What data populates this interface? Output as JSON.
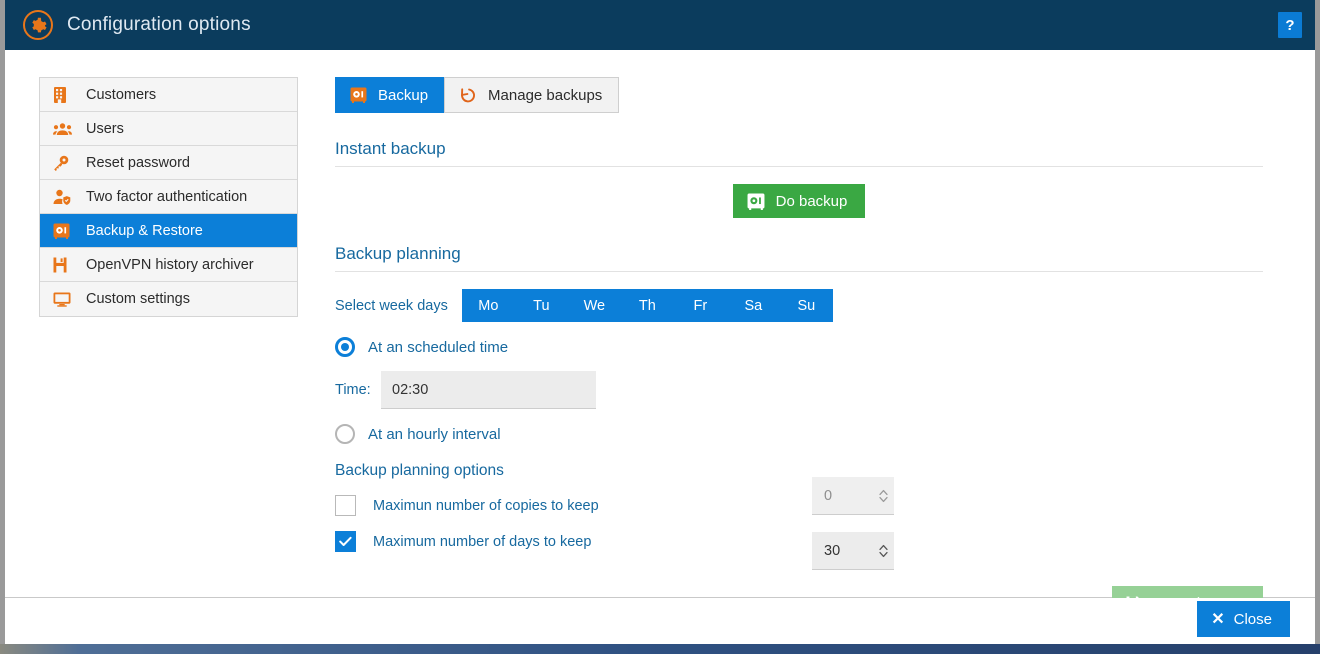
{
  "titlebar": {
    "title": "Configuration options",
    "icon": "gear-icon",
    "help_label": "?"
  },
  "sidebar": {
    "items": [
      {
        "label": "Customers",
        "icon": "building-icon",
        "active": false
      },
      {
        "label": "Users",
        "icon": "users-icon",
        "active": false
      },
      {
        "label": "Reset password",
        "icon": "key-icon",
        "active": false
      },
      {
        "label": "Two factor authentication",
        "icon": "user-shield-icon",
        "active": false
      },
      {
        "label": "Backup & Restore",
        "icon": "safe-icon",
        "active": true
      },
      {
        "label": "OpenVPN history archiver",
        "icon": "floppy-icon",
        "active": false
      },
      {
        "label": "Custom settings",
        "icon": "monitor-icon",
        "active": false
      }
    ]
  },
  "tabs": [
    {
      "label": "Backup",
      "icon": "safe-icon",
      "active": true
    },
    {
      "label": "Manage backups",
      "icon": "restore-arrow-icon",
      "active": false
    }
  ],
  "instant_backup": {
    "heading": "Instant backup",
    "do_backup_label": "Do backup",
    "do_backup_icon": "safe-icon",
    "do_backup_color": "#3aa843"
  },
  "backup_planning": {
    "heading": "Backup planning",
    "weekdays_label": "Select week days",
    "weekdays": [
      {
        "label": "Mo",
        "selected": true
      },
      {
        "label": "Tu",
        "selected": true
      },
      {
        "label": "We",
        "selected": true
      },
      {
        "label": "Th",
        "selected": true
      },
      {
        "label": "Fr",
        "selected": true
      },
      {
        "label": "Sa",
        "selected": true
      },
      {
        "label": "Su",
        "selected": true
      }
    ],
    "scheduled_radio_label": "At an scheduled time",
    "scheduled_radio_selected": true,
    "time_label": "Time:",
    "time_value": "02:30",
    "hourly_radio_label": "At an hourly interval",
    "hourly_radio_selected": false
  },
  "planning_options": {
    "heading": "Backup planning options",
    "max_copies_label": "Maximun number of copies to keep",
    "max_copies_checked": false,
    "max_copies_value": "0",
    "max_days_label": "Maximum number of days to keep",
    "max_days_checked": true,
    "max_days_value": "30"
  },
  "actions": {
    "save_label": "Save changes",
    "save_icon": "floppy-icon",
    "save_enabled": false,
    "close_label": "Close",
    "close_icon": "close-x-icon"
  },
  "colors": {
    "titlebar": "#0b3c5d",
    "accent_blue": "#0c7fd8",
    "accent_orange": "#e8761a",
    "heading_blue": "#17699f",
    "green": "#3aa843",
    "green_disabled": "#96d196"
  }
}
